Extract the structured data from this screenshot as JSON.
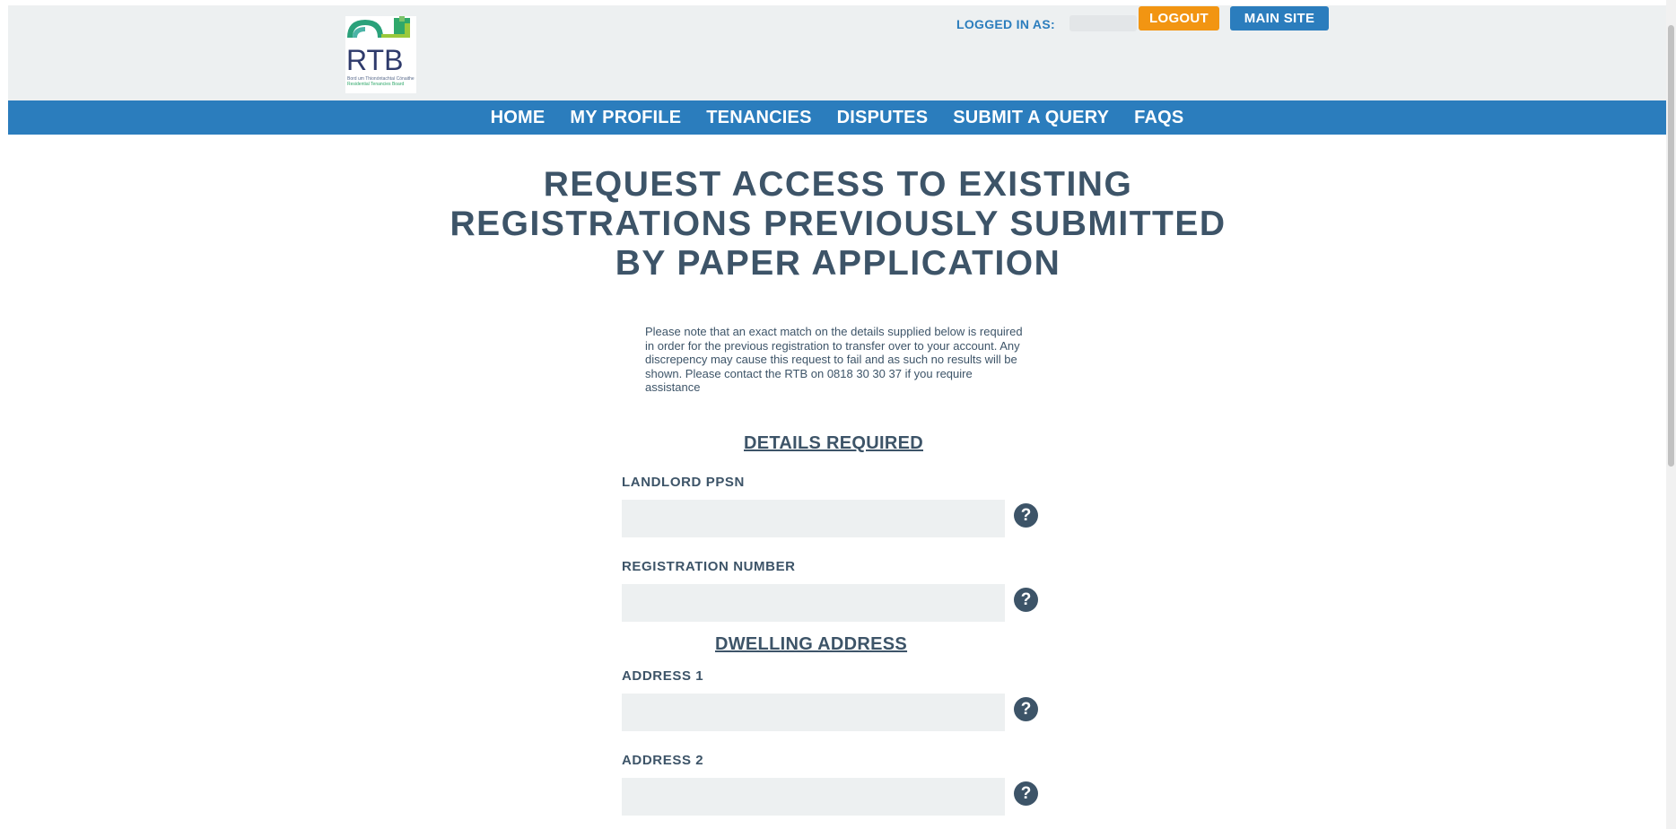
{
  "header": {
    "logo_text": "RTB",
    "logo_sub1": "Bord um Thionóntachtaí Cónaithe",
    "logo_sub2": "Residential Tenancies Board",
    "logged_in_label": "LOGGED IN AS:",
    "logout_label": "LOGOUT",
    "main_site_label": "MAIN SITE",
    "brand_colors": {
      "blue": "#2b7dbd",
      "orange": "#f29512",
      "navy": "#3d5468"
    }
  },
  "nav": {
    "items": [
      {
        "label": "HOME"
      },
      {
        "label": "MY PROFILE"
      },
      {
        "label": "TENANCIES"
      },
      {
        "label": "DISPUTES"
      },
      {
        "label": "SUBMIT A QUERY"
      },
      {
        "label": "FAQS"
      }
    ]
  },
  "main": {
    "title_line1": "REQUEST ACCESS TO EXISTING",
    "title_line2": "REGISTRATIONS PREVIOUSLY SUBMITTED",
    "title_line3": "BY PAPER APPLICATION",
    "notice": "Please note that an exact match on the details supplied below is required in order for the previous registration to transfer over to your account. Any discrepency may cause this request to fail and as such no results will be shown. Please contact the RTB on 0818 30 30 37 if you require assistance",
    "details_heading": "DETAILS REQUIRED",
    "dwelling_heading": "DWELLING ADDRESS",
    "fields": [
      {
        "label": "LANDLORD PPSN",
        "value": ""
      },
      {
        "label": "REGISTRATION NUMBER",
        "value": ""
      },
      {
        "label": "ADDRESS 1",
        "value": ""
      },
      {
        "label": "ADDRESS 2",
        "value": ""
      }
    ],
    "help_icon": "question-circle-icon",
    "help_glyph": "?"
  }
}
